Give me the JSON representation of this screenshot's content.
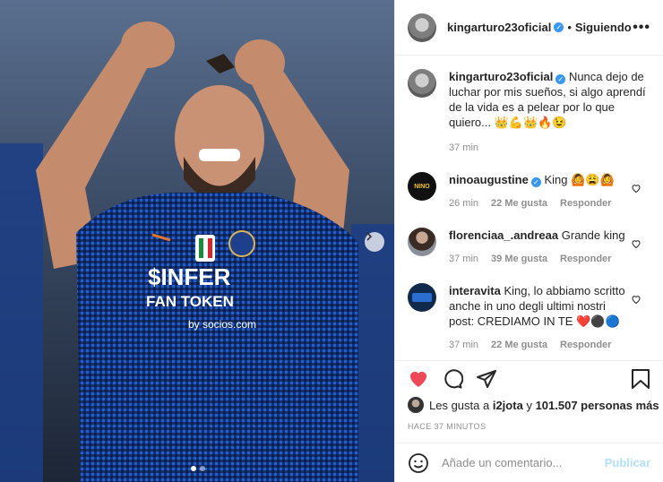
{
  "post": {
    "author": "kingarturo23oficial",
    "follow_state": "Siguiendo",
    "separator": "•",
    "more": "•••",
    "verified_mark": "✓",
    "caption": "Nunca dejo de luchar por mis sueños, si algo aprendí de la vida es a pelear por lo que quiero... 👑💪👑🔥😉",
    "caption_time": "37 min",
    "likes_prefix": "Les gusta a",
    "likes_user": "i2jota",
    "likes_joiner": "y",
    "likes_count": "101.507 personas más",
    "posted_ago": "HACE 37 MINUTOS",
    "carousel_index": 1,
    "carousel_total": 2,
    "photo_text": {
      "sponsor": "$INFER",
      "line2": "FAN TOKEN",
      "line3": "by socios.com"
    }
  },
  "comments": [
    {
      "user": "ninoaugustine",
      "verified": true,
      "text": "King 🙆😩🙆",
      "time": "26 min",
      "likes": "22 Me gusta",
      "reply": "Responder",
      "avatar_text": "NINO"
    },
    {
      "user": "florenciaa_.andreaa",
      "verified": false,
      "text": "Grande king",
      "time": "37 min",
      "likes": "39 Me gusta",
      "reply": "Responder"
    },
    {
      "user": "interavita",
      "verified": false,
      "text": "King, lo abbiamo scritto anche in uno degli ultimi nostri post: CREDIAMO IN TE ❤️⚫🔵",
      "time": "37 min",
      "likes": "22 Me gusta",
      "reply": "Responder"
    }
  ],
  "composer": {
    "placeholder": "Añade un comentario...",
    "publish": "Publicar"
  },
  "colors": {
    "like_red": "#ed4956",
    "verified_blue": "#3897f0",
    "publish_disabled": "#b2dffc",
    "meta_gray": "#8e8e8e"
  },
  "icons": [
    "heart-filled-icon",
    "comment-icon",
    "share-icon",
    "bookmark-icon",
    "emoji-icon",
    "chevron-right-icon",
    "heart-outline-icon"
  ]
}
